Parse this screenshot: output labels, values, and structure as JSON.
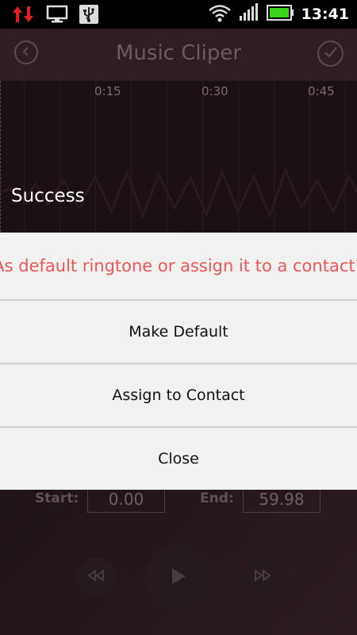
{
  "status_bar": {
    "time": "13:41",
    "icons": [
      "data-transfer-icon",
      "computer-icon",
      "usb-icon",
      "wifi-icon",
      "signal-icon",
      "battery-icon"
    ]
  },
  "app": {
    "title": "Music Cliper",
    "timeline": [
      "0:15",
      "0:30",
      "0:45"
    ],
    "toast": "Success",
    "start_label": "Start:",
    "start_value": "0.00",
    "end_label": "End:",
    "end_value": "59.98"
  },
  "dialog": {
    "message": "As default ringtone or assign it to a contact?",
    "buttons": {
      "make_default": "Make Default",
      "assign_contact": "Assign to Contact",
      "close": "Close"
    }
  },
  "colors": {
    "message": "#ea5757",
    "dialog_bg": "#f1f1f1",
    "divider": "#d0d0d0"
  }
}
